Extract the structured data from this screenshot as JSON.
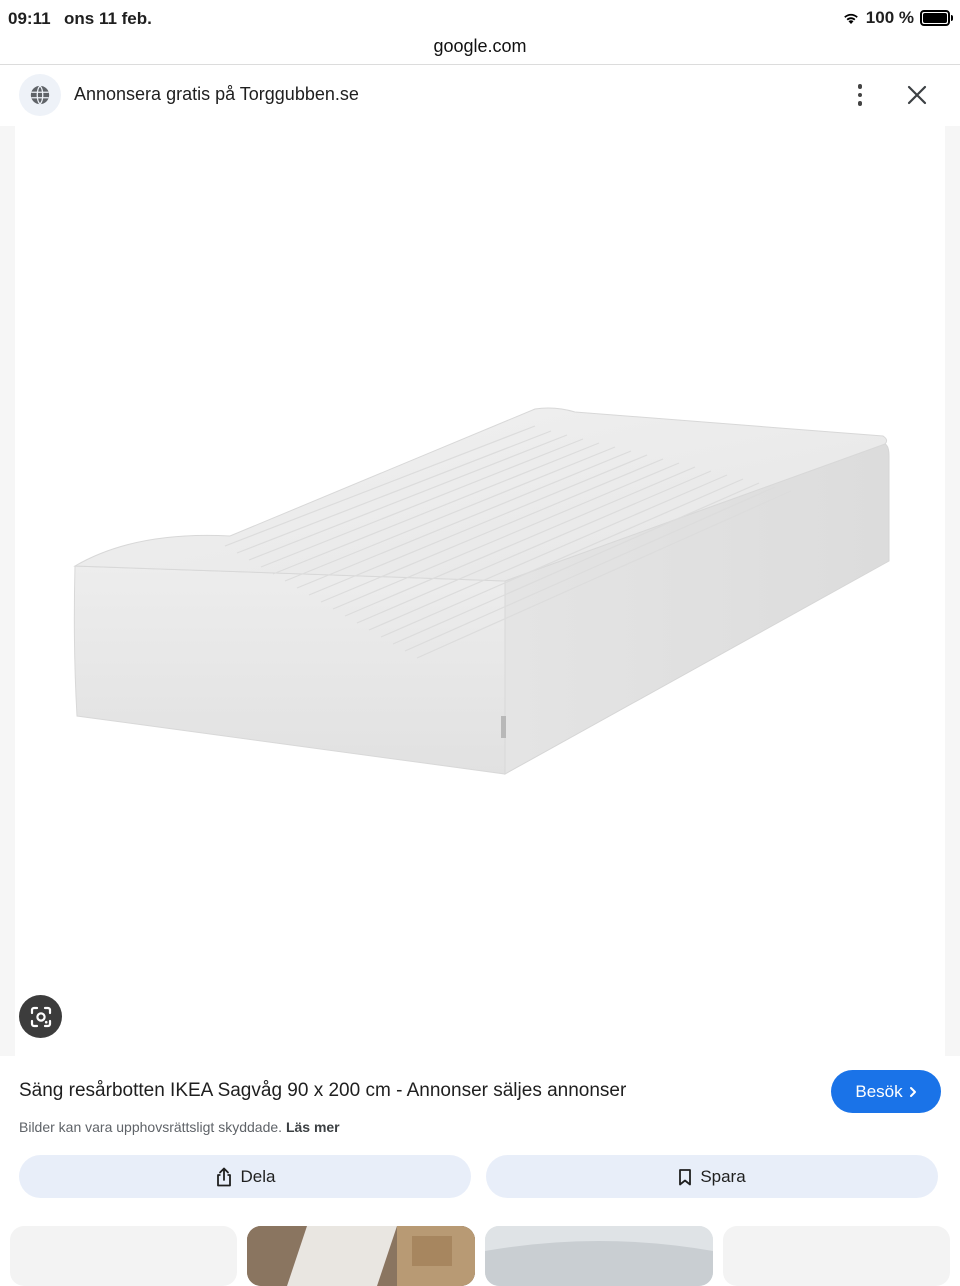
{
  "status_bar": {
    "time": "09:11",
    "date": "ons 11 feb.",
    "battery": "100 %"
  },
  "browser": {
    "url": "google.com"
  },
  "header": {
    "title": "Annonsera gratis på Torggubben.se",
    "icon": "globe-icon"
  },
  "result": {
    "title": "Säng resårbotten IKEA Sagvåg 90 x 200 cm - Annonser säljes annonser",
    "visit_label": "Besök",
    "copyright_text": "Bilder kan vara upphovsrättsligt skyddade.",
    "read_more": "Läs mer"
  },
  "actions": {
    "share_label": "Dela",
    "save_label": "Spara"
  },
  "colors": {
    "accent": "#1a73e8",
    "action_bg": "#e8eef9"
  }
}
